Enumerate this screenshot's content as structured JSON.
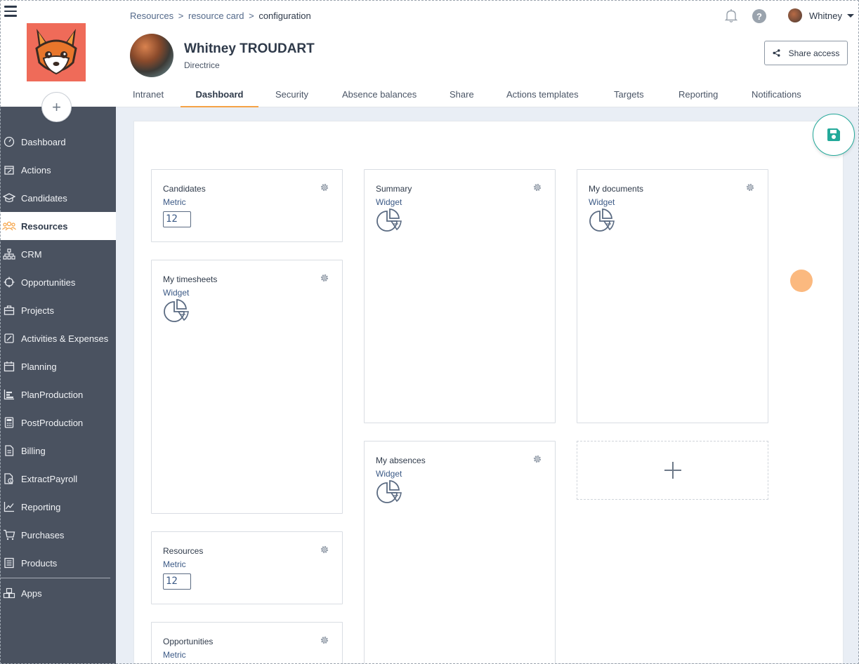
{
  "sidebar": {
    "items": [
      {
        "label": "Dashboard",
        "icon": "dashboard-gauge-icon"
      },
      {
        "label": "Actions",
        "icon": "calendar-edit-icon"
      },
      {
        "label": "Candidates",
        "icon": "graduation-cap-icon"
      },
      {
        "label": "Resources",
        "icon": "users-icon",
        "active": true
      },
      {
        "label": "CRM",
        "icon": "org-chart-icon"
      },
      {
        "label": "Opportunities",
        "icon": "crosshair-icon"
      },
      {
        "label": "Projects",
        "icon": "briefcase-icon"
      },
      {
        "label": "Activities & Expenses",
        "icon": "edit-square-icon"
      },
      {
        "label": "Planning",
        "icon": "calendar-icon"
      },
      {
        "label": "PlanProduction",
        "icon": "bar-chart-icon"
      },
      {
        "label": "PostProduction",
        "icon": "calculator-icon"
      },
      {
        "label": "Billing",
        "icon": "invoice-icon"
      },
      {
        "label": "ExtractPayroll",
        "icon": "payroll-icon"
      },
      {
        "label": "Reporting",
        "icon": "line-chart-icon"
      },
      {
        "label": "Purchases",
        "icon": "cart-icon"
      },
      {
        "label": "Products",
        "icon": "catalog-icon"
      },
      {
        "label": "Apps",
        "icon": "cubes-icon"
      }
    ]
  },
  "breadcrumb": {
    "items": [
      "Resources",
      "resource card"
    ],
    "current": "configuration"
  },
  "user": {
    "name": "Whitney"
  },
  "profile": {
    "name": "Whitney TROUDART",
    "role": "Directrice"
  },
  "share_label": "Share access",
  "tabs": [
    {
      "label": "Intranet"
    },
    {
      "label": "Dashboard",
      "active": true
    },
    {
      "label": "Security"
    },
    {
      "label": "Absence balances"
    },
    {
      "label": "Share"
    },
    {
      "label": "Actions templates"
    },
    {
      "label": "Targets"
    },
    {
      "label": "Reporting"
    },
    {
      "label": "Notifications"
    }
  ],
  "cards": [
    {
      "title": "Candidates",
      "type": "Metric",
      "value": "12"
    },
    {
      "title": "My timesheets",
      "type": "Widget"
    },
    {
      "title": "Resources",
      "type": "Metric",
      "value": "12"
    },
    {
      "title": "Opportunities",
      "type": "Metric"
    },
    {
      "title": "Summary",
      "type": "Widget"
    },
    {
      "title": "My absences",
      "type": "Widget"
    },
    {
      "title": "My documents",
      "type": "Widget"
    }
  ],
  "colors": {
    "sidebar": "#4a5260",
    "accent_tab": "#f5a346",
    "save": "#23a99a",
    "link": "#3c5a86"
  }
}
